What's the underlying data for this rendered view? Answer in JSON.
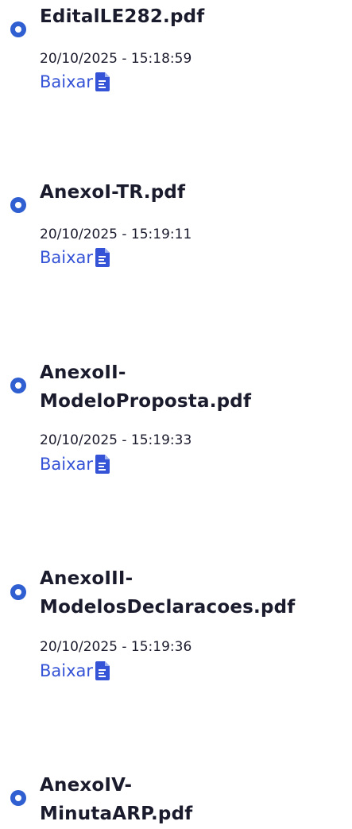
{
  "files": [
    {
      "name_lines": [
        "EditalLE282.pdf"
      ],
      "date": "20/10/2025 - 15:18:59",
      "download_label": "Baixar",
      "icon": "file-document-icon"
    },
    {
      "name_lines": [
        "AnexoI-TR.pdf"
      ],
      "date": "20/10/2025 - 15:19:11",
      "download_label": "Baixar",
      "icon": "file-document-icon"
    },
    {
      "name_lines": [
        "AnexoII-",
        "ModeloProposta.pdf"
      ],
      "date": "20/10/2025 - 15:19:33",
      "download_label": "Baixar",
      "icon": "file-document-icon"
    },
    {
      "name_lines": [
        "AnexoIII-",
        "ModelosDeclaracoes.pdf"
      ],
      "date": "20/10/2025 - 15:19:36",
      "download_label": "Baixar",
      "icon": "file-document-icon"
    },
    {
      "name_lines": [
        "AnexoIV-",
        "MinutaARP.pdf"
      ]
    }
  ],
  "colors": {
    "bullet": "#2f5fd0",
    "link": "#3553d6",
    "text": "#1b1b2e"
  }
}
